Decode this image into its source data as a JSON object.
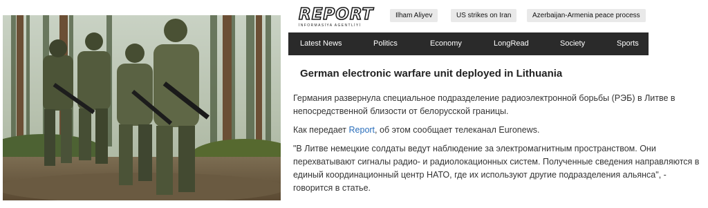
{
  "logo": {
    "main": "REPORT",
    "sub": "İNFORMASİYA AGENTLİYİ"
  },
  "tags": [
    "Ilham Aliyev",
    "US strikes on Iran",
    "Azerbaijan-Armenia peace process"
  ],
  "nav": [
    "Latest News",
    "Politics",
    "Economy",
    "LongRead",
    "Society",
    "Sports"
  ],
  "article": {
    "headline": "German electronic warfare unit deployed in Lithuania",
    "p1": "Германия развернула специальное подразделение радиоэлектронной борьбы (РЭБ) в Литве в непосредственной близости от белорусской границы.",
    "p2_before": "Как передает ",
    "p2_link": "Report",
    "p2_after": ", об этом сообщает телеканал Euronews.",
    "p3": "\"В Литве немецкие солдаты ведут наблюдение за электромагнитным пространством. Они перехватывают сигналы радио- и радиолокационных систем. Полученные сведения направляются в единый координационный центр НАТО, где их используют другие подразделения альянса\", - говорится в статье."
  }
}
